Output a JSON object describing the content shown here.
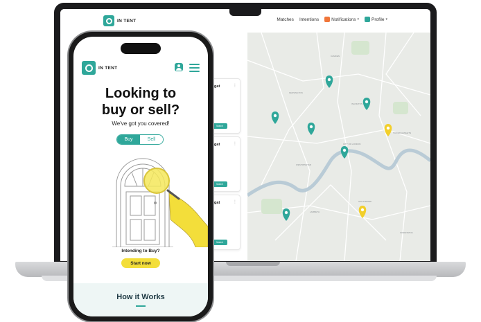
{
  "brand": {
    "name": "IN TENT",
    "accent": "#2fa79a",
    "highlight": "#f3de3a"
  },
  "desktop": {
    "nav": [
      {
        "label": "Matches"
      },
      {
        "label": "Intentions"
      },
      {
        "label": "Notifications",
        "icon": "bell-icon"
      },
      {
        "label": "Profile",
        "icon": "user-icon"
      }
    ],
    "cards": [
      {
        "title": "egat",
        "button": "Match"
      },
      {
        "title": "egat",
        "button": "Match"
      },
      {
        "title": "egat",
        "button": "Match"
      }
    ],
    "map": {
      "pins": [
        {
          "color": "teal"
        },
        {
          "color": "teal"
        },
        {
          "color": "teal"
        },
        {
          "color": "yellow"
        },
        {
          "color": "teal"
        },
        {
          "color": "teal"
        },
        {
          "color": "teal"
        },
        {
          "color": "yellow"
        }
      ]
    }
  },
  "phone": {
    "title_line1": "Looking to",
    "title_line2": "buy or sell?",
    "subtitle": "We've got you covered!",
    "toggle": {
      "buy": "Buy",
      "sell": "Sell",
      "selected": "Buy"
    },
    "prompt": "Intending to Buy?",
    "cta": "Start now",
    "section_title": "How it Works"
  }
}
